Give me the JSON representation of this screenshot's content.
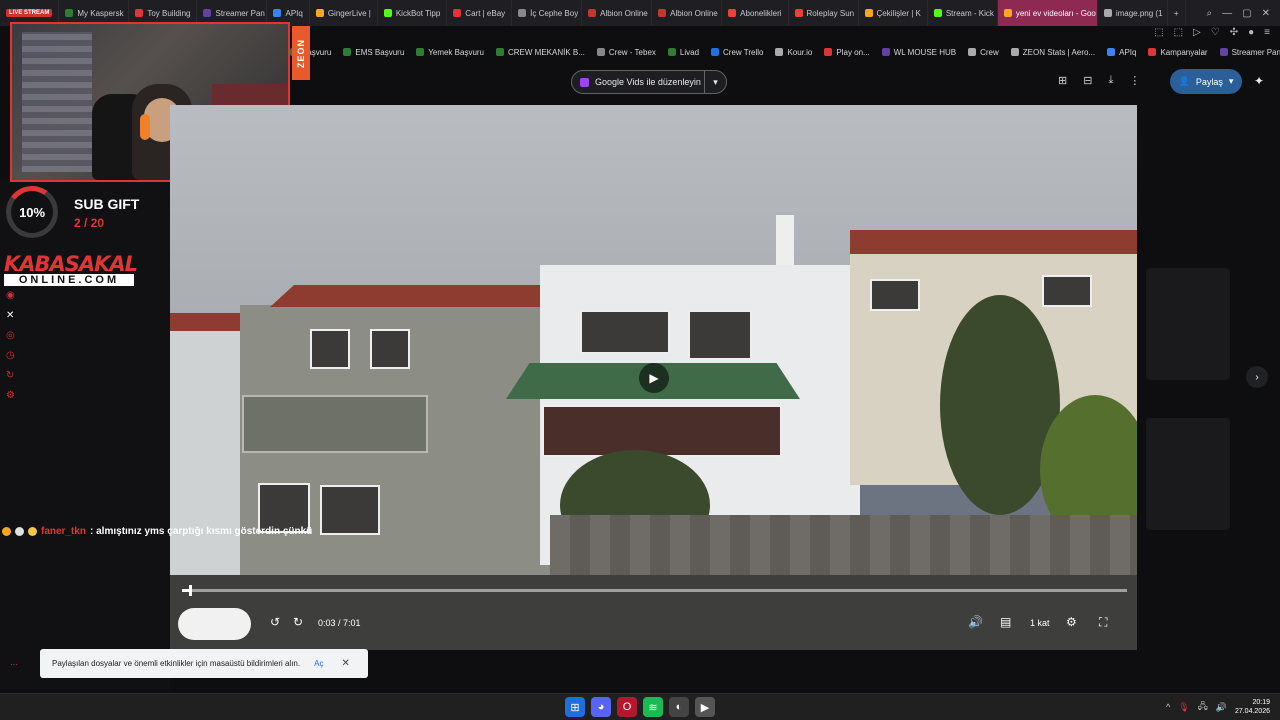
{
  "tabs": [
    {
      "label": "LIVE STREAM",
      "color": "#d32f2f",
      "live": true
    },
    {
      "label": "My Kaspersk",
      "color": "#2e7d32"
    },
    {
      "label": "Toy Building",
      "color": "#e03535"
    },
    {
      "label": "Streamer Pan",
      "color": "#6441a4"
    },
    {
      "label": "APIq",
      "color": "#3b82f6"
    },
    {
      "label": "GingerLive |",
      "color": "#f5a623"
    },
    {
      "label": "KickBot Tipp",
      "color": "#53fc18"
    },
    {
      "label": "Cart | eBay",
      "color": "#e53238"
    },
    {
      "label": "İç Cephe Boy",
      "color": "#888888"
    },
    {
      "label": "Albion Online",
      "color": "#c0392b"
    },
    {
      "label": "Albion Online",
      "color": "#c0392b"
    },
    {
      "label": "Abonelikleri",
      "color": "#ea4335"
    },
    {
      "label": "Roleplay Sun",
      "color": "#ea4335"
    },
    {
      "label": "Çekilişler | K",
      "color": "#f5a623"
    },
    {
      "label": "Stream - Kick",
      "color": "#53fc18"
    },
    {
      "label": "yeni ev videoları - Goo",
      "color": "#f5a623",
      "active": true
    },
    {
      "label": "image.png (1",
      "color": "#aaaaaa"
    }
  ],
  "tab_new": "+",
  "bookmarks": [
    {
      "label": "Başvuru",
      "color": "#2e7d32"
    },
    {
      "label": "EMS Başvuru",
      "color": "#2e7d32"
    },
    {
      "label": "Yemek Başvuru",
      "color": "#2e7d32"
    },
    {
      "label": "CREW MEKANİK B...",
      "color": "#2e7d32"
    },
    {
      "label": "Crew - Tebex",
      "color": "#888888"
    },
    {
      "label": "Livad",
      "color": "#2e7d32"
    },
    {
      "label": "Crew Trello",
      "color": "#1a73e8"
    },
    {
      "label": "Kour.io",
      "color": "#aaaaaa"
    },
    {
      "label": "Play on...",
      "color": "#e03535"
    },
    {
      "label": "WL MOUSE HUB",
      "color": "#6441a4"
    },
    {
      "label": "Crew",
      "color": "#aaaaaa"
    },
    {
      "label": "ZEON Stats | Aero...",
      "color": "#aaaaaa"
    },
    {
      "label": "APIq",
      "color": "#3b82f6"
    },
    {
      "label": "Kampanyalar",
      "color": "#e03535"
    },
    {
      "label": "Streamer Panel",
      "color": "#6441a4"
    }
  ],
  "app": {
    "edit_button": "Google Vids ile düzenleyin",
    "share_button": "Paylaş",
    "accent": "#2b5f9a"
  },
  "overlay": {
    "zeon": "ZEON",
    "gift_percent": "10%",
    "gift_progress": 0.1,
    "gift_title": "SUB GIFT",
    "gift_count": "2 / 20",
    "brand_top": "KABASAKAL",
    "brand_bottom": "ONLINE.COM"
  },
  "chat": {
    "user": "faner_tkn",
    "message": ": almıştınız yms çarptığı kısmı gösterdin çünkü"
  },
  "player": {
    "time": "0:03 / 7:01",
    "progress": 0.007,
    "speed": "1 kat"
  },
  "toast": {
    "text": "Paylaşılan dosyalar ve önemli etkinlikler için masaüstü bildirimleri alın.",
    "action": "Aç"
  },
  "taskbar": {
    "time": "20:19",
    "date": "27.04.2026"
  },
  "icons": {
    "edit": "video-icon",
    "share": "person-add-icon"
  }
}
